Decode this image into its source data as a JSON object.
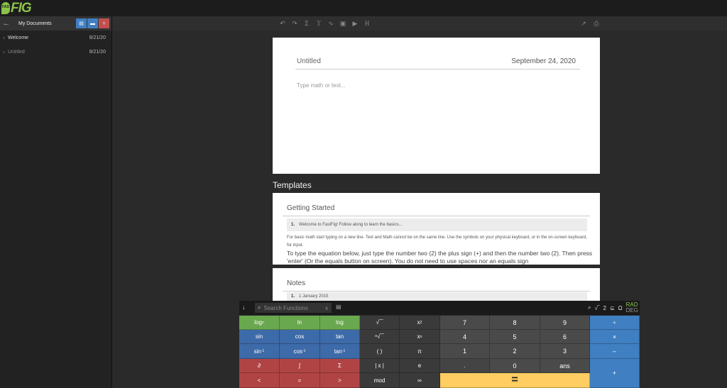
{
  "brand": {
    "leaf_text": "FAST",
    "name": "FIG"
  },
  "sidebar": {
    "title": "My Documents",
    "documents": [
      {
        "name": "Welcome",
        "date": "9/21/20"
      },
      {
        "name": "Untitled",
        "date": "9/21/20"
      }
    ]
  },
  "document": {
    "title": "Untitled",
    "date": "September 24, 2020",
    "placeholder": "Type math or text..."
  },
  "templates": {
    "label": "Templates",
    "items": [
      {
        "title": "Getting Started",
        "step_number": "1.",
        "step_text": "Welcome to FastFig! Follow along to learn the basics...",
        "body": "For basic math start typing on a new line.  Text and Math cannot be on the same line.  Use the symbols on your physical keyboard, or in the on-screen keyboard, for input.",
        "body2": "To type the equation below, just type the number two (2) the plus sign (+) and then the number two (2). Then press 'enter' (Or the equals button on screen).  You do not need to use spaces nor an equals sign"
      },
      {
        "title": "Notes",
        "step_number": "1.",
        "step_text": "1 January 2015"
      }
    ]
  },
  "calculator": {
    "search_placeholder": "Search Functions",
    "search_clear": "x",
    "mode_radical": "√‾",
    "mode_number": "2",
    "mode_subset": "⊆",
    "mode_omega": "Ω",
    "angle_rad": "RAD",
    "angle_deg": "DEG",
    "keys": {
      "log_n": "log",
      "log_n_sub": "n",
      "ln": "ln",
      "log": "log",
      "sin": "sin",
      "cos": "cos",
      "tan": "tan",
      "asin": "sin",
      "acos": "cos",
      "atan": "tan",
      "inv_sup": "-1",
      "partial": "∂",
      "integral": "∫",
      "sum": "Σ",
      "lt": "<",
      "eq_rel": "=",
      "gt": ">",
      "sqrt": "√‾‾",
      "square": "x",
      "square_sup": "2",
      "nroot": "ⁿ√‾‾",
      "power": "x",
      "power_sup": "n",
      "parens": "(  )",
      "pi": "π",
      "abs": "| x |",
      "e": "e",
      "mod": "mod",
      "infinity": "∞",
      "d7": "7",
      "d8": "8",
      "d9": "9",
      "d4": "4",
      "d5": "5",
      "d6": "6",
      "d1": "1",
      "d2": "2",
      "d3": "3",
      "dot": ".",
      "d0": "0",
      "ans": "ans",
      "div": "÷",
      "mul": "×",
      "sub": "–",
      "add": "+",
      "equals": "="
    }
  },
  "colors": {
    "brand_green": "#8bc34a",
    "func_green": "#6aa84f",
    "trig_blue": "#3d6aa8",
    "calc_red": "#b04444",
    "operator_blue": "#3f7fc2",
    "equals_yellow": "#ffcd61"
  }
}
